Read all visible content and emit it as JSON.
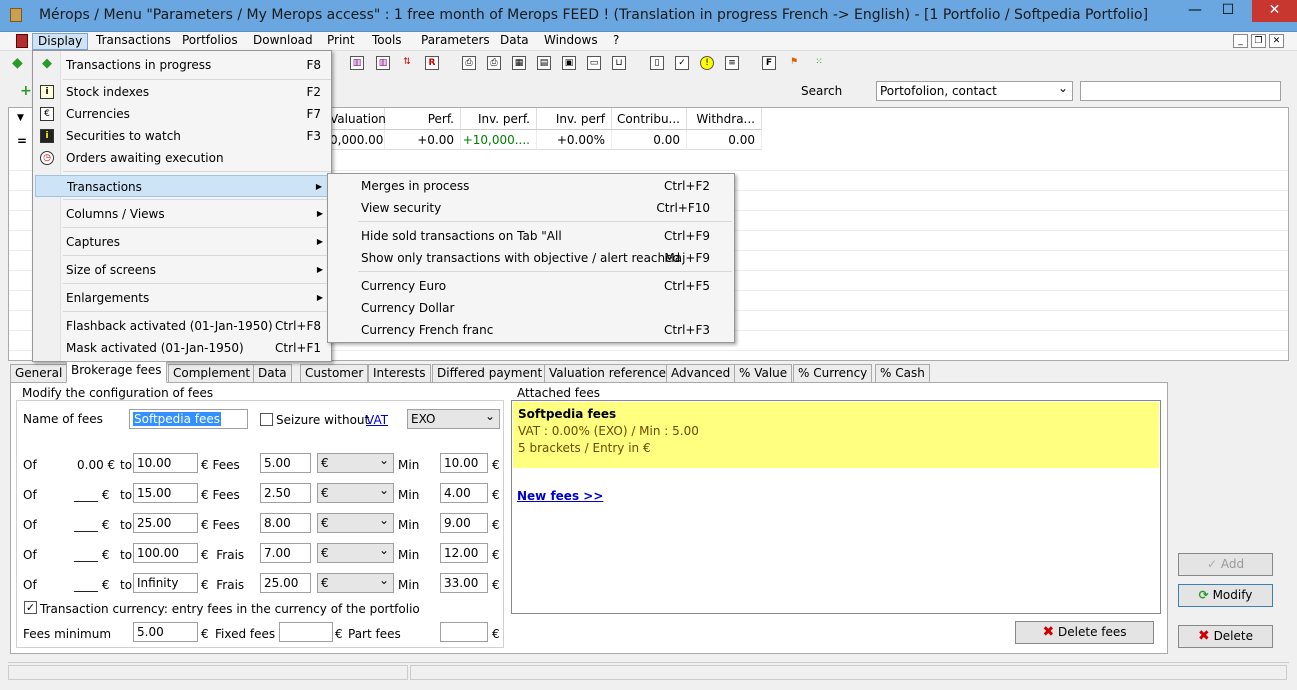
{
  "window": {
    "title": "Mérops / Menu \"Parameters / My Merops access\" : 1 free month of Merops FEED ! (Translation in progress French -> English) - [1 Portfolio / Softpedia Portfolio]",
    "minimize": "—",
    "maximize": "☐",
    "close": "✕"
  },
  "menubar": [
    "Display",
    "Transactions",
    "Portfolios",
    "Download",
    "Print",
    "Tools",
    "Parameters",
    "Data",
    "Windows",
    "?"
  ],
  "search": {
    "label": "Search",
    "combo_value": "Portofolion, contact",
    "input_value": ""
  },
  "grid": {
    "headers": [
      "Valuation",
      "Perf.",
      "Inv. perf.",
      "Inv. perf",
      "Contribu...",
      "Withdra..."
    ],
    "row": [
      "0,000.00",
      "+0.00",
      "+10,000....",
      "+0.00%",
      "0.00",
      "0.00"
    ],
    "row_marker": "="
  },
  "display_menu": {
    "items": [
      {
        "label": "Transactions in progress",
        "shortcut": "F8",
        "icon": "tag-icon"
      },
      {
        "label": "Stock indexes",
        "shortcut": "F2",
        "icon": "info-icon"
      },
      {
        "label": "Currencies",
        "shortcut": "F7",
        "icon": "euro-icon"
      },
      {
        "label": "Securities to watch",
        "shortcut": "F3",
        "icon": "info-dark-icon"
      },
      {
        "label": "Orders awaiting execution",
        "shortcut": "",
        "icon": "clock-icon"
      },
      {
        "label": "Transactions",
        "shortcut": "",
        "submenu": true
      },
      {
        "label": "Columns / Views",
        "shortcut": "",
        "submenu": true
      },
      {
        "label": "Captures",
        "shortcut": "",
        "submenu": true
      },
      {
        "label": "Size of screens",
        "shortcut": "",
        "submenu": true
      },
      {
        "label": "Enlargements",
        "shortcut": "",
        "submenu": true
      },
      {
        "label": "Flashback activated (01-Jan-1950)",
        "shortcut": "Ctrl+F8"
      },
      {
        "label": "Mask activated (01-Jan-1950)",
        "shortcut": "Ctrl+F1"
      }
    ]
  },
  "transactions_submenu": {
    "items": [
      {
        "label": "Merges in process",
        "shortcut": "Ctrl+F2"
      },
      {
        "label": "View security",
        "shortcut": "Ctrl+F10"
      },
      {
        "label": "Hide sold transactions on Tab \"All",
        "shortcut": "Ctrl+F9"
      },
      {
        "label": "Show only transactions with objective / alert reached",
        "shortcut": "Maj+F9"
      },
      {
        "label": "Currency Euro",
        "shortcut": "Ctrl+F5"
      },
      {
        "label": "Currency Dollar",
        "shortcut": ""
      },
      {
        "label": "Currency French franc",
        "shortcut": "Ctrl+F3"
      }
    ]
  },
  "tabs": [
    "General",
    "Brokerage fees",
    "Complement",
    "Data",
    "Customer",
    "Interests",
    "Differed payment",
    "Valuation reference",
    "Advanced",
    "% Value",
    "% Currency",
    "% Cash"
  ],
  "fees_form": {
    "group_title": "Modify the configuration of fees",
    "name_label": "Name of fees",
    "name_value": "Softpedia fees",
    "seizure_label": "Seizure without",
    "vat_link": "VAT",
    "vat_combo": "EXO",
    "brackets": [
      {
        "of_label": "Of",
        "from": "0.00 €",
        "to_label": "to",
        "to": "10.00",
        "fees_label": "€ Fees",
        "fee": "5.00",
        "currency": "€",
        "min_label": "Min",
        "min": "10.00",
        "unit": "€"
      },
      {
        "of_label": "Of",
        "from": "____ €",
        "to_label": "to",
        "to": "15.00",
        "fees_label": "€ Fees",
        "fee": "2.50",
        "currency": "€",
        "min_label": "Min",
        "min": "4.00",
        "unit": "€"
      },
      {
        "of_label": "Of",
        "from": "____ €",
        "to_label": "to",
        "to": "25.00",
        "fees_label": "€ Fees",
        "fee": "8.00",
        "currency": "€",
        "min_label": "Min",
        "min": "9.00",
        "unit": "€"
      },
      {
        "of_label": "Of",
        "from": "____ €",
        "to_label": "to",
        "to": "100.00",
        "fees_label": "€  Frais",
        "fee": "7.00",
        "currency": "€",
        "min_label": "Min",
        "min": "12.00",
        "unit": "€"
      },
      {
        "of_label": "Of",
        "from": "____ €",
        "to_label": "to",
        "to": "Infinity",
        "fees_label": "€  Frais",
        "fee": "25.00",
        "currency": "€",
        "min_label": "Min",
        "min": "33.00",
        "unit": "€"
      }
    ],
    "transaction_currency_label": "Transaction currency: entry fees in the currency of the portfolio",
    "fees_minimum_label": "Fees minimum",
    "fees_minimum_value": "5.00",
    "fees_minimum_unit": "€",
    "fixed_fees_label": "Fixed fees",
    "fixed_fees_value": "",
    "fixed_fees_unit": "€",
    "part_fees_label": "Part fees",
    "part_fees_value": "",
    "part_fees_unit": "€"
  },
  "attached_fees": {
    "title": "Attached fees",
    "name": "Softpedia fees",
    "line1": "VAT : 0.00% (EXO) / Min : 5.00",
    "line2": "5 brackets / Entry in €",
    "new_fees_link": "New fees >>"
  },
  "buttons": {
    "delete_fees": "Delete fees",
    "add": "Add",
    "modify": "Modify",
    "delete": "Delete"
  },
  "colors": {
    "titlebar": "#6aa7e1",
    "highlight": "#cde3f6",
    "attached_yellow": "#ffff80",
    "link": "#0000cc",
    "perf_green": "#008000"
  }
}
